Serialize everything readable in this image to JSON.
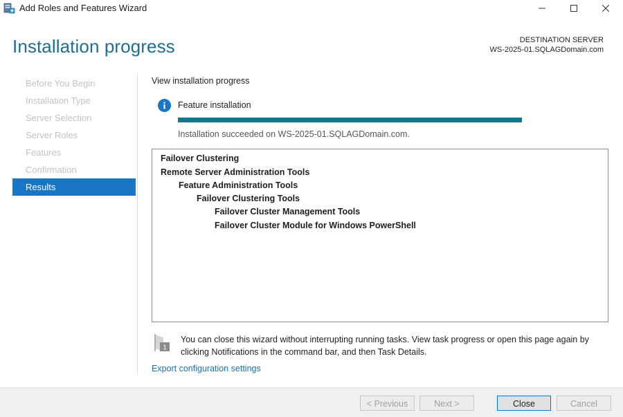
{
  "window": {
    "title": "Add Roles and Features Wizard",
    "minimize_symbol": "—",
    "maximize_symbol": "☐",
    "close_symbol": "✕"
  },
  "header": {
    "page_title": "Installation progress",
    "destination_label": "DESTINATION SERVER",
    "destination_server": "WS-2025-01.SQLAGDomain.com"
  },
  "nav": {
    "items": [
      {
        "label": "Before You Begin",
        "active": false
      },
      {
        "label": "Installation Type",
        "active": false
      },
      {
        "label": "Server Selection",
        "active": false
      },
      {
        "label": "Server Roles",
        "active": false
      },
      {
        "label": "Features",
        "active": false
      },
      {
        "label": "Confirmation",
        "active": false
      },
      {
        "label": "Results",
        "active": true
      }
    ]
  },
  "main": {
    "view_label": "View installation progress",
    "feature_label": "Feature installation",
    "progress_percent": 100,
    "status_text": "Installation succeeded on WS-2025-01.SQLAGDomain.com.",
    "results": [
      {
        "text": "Failover Clustering",
        "level": 0
      },
      {
        "text": "Remote Server Administration Tools",
        "level": 0
      },
      {
        "text": "Feature Administration Tools",
        "level": 1
      },
      {
        "text": "Failover Clustering Tools",
        "level": 2
      },
      {
        "text": "Failover Cluster Management Tools",
        "level": 3
      },
      {
        "text": "Failover Cluster Module for Windows PowerShell",
        "level": 3
      }
    ],
    "notification_badge": "1",
    "notification_text": "You can close this wizard without interrupting running tasks. View task progress or open this page again by clicking Notifications in the command bar, and then Task Details.",
    "export_link": "Export configuration settings"
  },
  "footer": {
    "previous_label": "< Previous",
    "next_label": "Next >",
    "close_label": "Close",
    "cancel_label": "Cancel"
  },
  "colors": {
    "title_accent": "#1c6f8f",
    "nav_active": "#1a76c4",
    "progress_fill": "#13788e",
    "link": "#1a73a8",
    "info_icon": "#1a76c4"
  },
  "icons": {
    "app": "server-wizard-icon",
    "info": "info-icon",
    "notification": "notification-flag-icon"
  }
}
